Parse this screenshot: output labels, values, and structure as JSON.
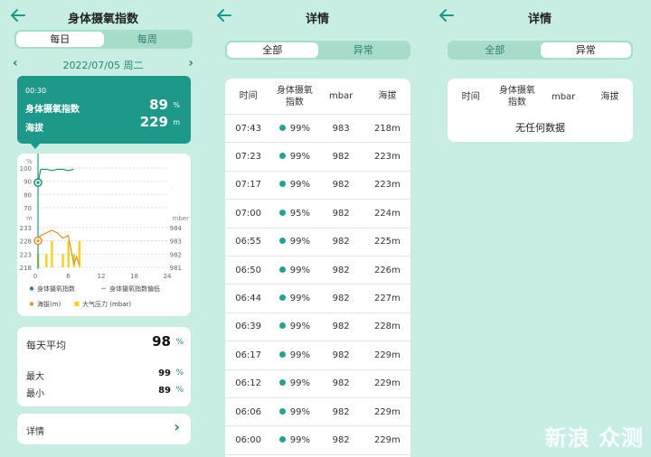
{
  "colors": {
    "accent": "#1e9989",
    "background": "#c8ede2",
    "segment": "#a7dccb",
    "series_spo2": "#1e8a7c",
    "series_alt": "#e1902c",
    "series_pressure": "#f2d21c"
  },
  "left": {
    "back_icon": "arrow-left-icon",
    "title": "身体摄氧指数",
    "tabs": [
      "每日",
      "每周"
    ],
    "date": "2022/07/05 周二",
    "tooltip": {
      "time": "00:30",
      "spo2_label": "身体摄氧指数",
      "spo2_value": "89",
      "spo2_unit": "%",
      "alt_label": "海拔",
      "alt_value": "229",
      "alt_unit": "m"
    },
    "stats": {
      "avg_label": "每天平均",
      "avg_value": "98",
      "avg_unit": "%",
      "max_label": "最大",
      "max_value": "99",
      "max_unit": "%",
      "min_label": "最小",
      "min_value": "89",
      "min_unit": "%"
    },
    "detail_label": "详情"
  },
  "chart_data": {
    "type": "line",
    "x_ticks": [
      "0",
      "6",
      "12",
      "18",
      "24"
    ],
    "top": {
      "unit": "%",
      "y_ticks": [
        "100",
        "90",
        "80",
        "70"
      ],
      "ylim": [
        70,
        100
      ]
    },
    "bottom": {
      "left_unit": "m",
      "left_ticks": [
        "233",
        "228",
        "223",
        "218"
      ],
      "left_lim": [
        218,
        233
      ],
      "right_unit": "mber",
      "right_ticks": [
        "984",
        "983",
        "982",
        "981"
      ],
      "right_lim": [
        981,
        984
      ]
    },
    "legend": [
      "身体摄氧指数",
      "身体摄氧指数偏低",
      "海拔(m)",
      "大气压力 (mbar)"
    ],
    "series": [
      {
        "name": "身体摄氧指数",
        "x": [
          0.5,
          1,
          2,
          3,
          4,
          5,
          6,
          7
        ],
        "y": [
          89,
          99,
          99,
          98,
          99,
          99,
          98,
          99
        ]
      },
      {
        "name": "海拔(m)",
        "x": [
          0.5,
          1,
          2,
          3,
          4,
          5,
          6,
          6.5,
          7,
          7.5,
          8
        ],
        "y": [
          229,
          230,
          231,
          232,
          231,
          229,
          230,
          225,
          219,
          222,
          219
        ]
      },
      {
        "name": "大气压力 (mbar)",
        "x": [
          0.5,
          1,
          2,
          3,
          4,
          5,
          6,
          7,
          8
        ],
        "y": [
          982,
          981,
          982,
          983,
          981,
          982,
          983,
          982,
          983
        ]
      }
    ]
  },
  "middle": {
    "back_icon": "arrow-left-icon",
    "title": "详情",
    "tabs": [
      "全部",
      "异常"
    ],
    "columns": [
      "时间",
      "身体摄氧\n指数",
      "mbar",
      "海拔"
    ],
    "rows": [
      [
        "07:43",
        "99%",
        "983",
        "218m"
      ],
      [
        "07:23",
        "99%",
        "982",
        "223m"
      ],
      [
        "07:17",
        "99%",
        "982",
        "223m"
      ],
      [
        "07:00",
        "95%",
        "982",
        "224m"
      ],
      [
        "06:55",
        "99%",
        "982",
        "225m"
      ],
      [
        "06:50",
        "99%",
        "982",
        "226m"
      ],
      [
        "06:44",
        "99%",
        "982",
        "227m"
      ],
      [
        "06:39",
        "99%",
        "982",
        "228m"
      ],
      [
        "06:17",
        "99%",
        "982",
        "229m"
      ],
      [
        "06:12",
        "99%",
        "982",
        "229m"
      ],
      [
        "06:06",
        "99%",
        "982",
        "229m"
      ],
      [
        "06:00",
        "99%",
        "982",
        "229m"
      ]
    ]
  },
  "right": {
    "back_icon": "arrow-left-icon",
    "title": "详情",
    "tabs": [
      "全部",
      "异常"
    ],
    "columns": [
      "时间",
      "身体摄氧\n指数",
      "mbar",
      "海拔"
    ],
    "empty": "无任何数据"
  },
  "watermark": "新浪 众测"
}
